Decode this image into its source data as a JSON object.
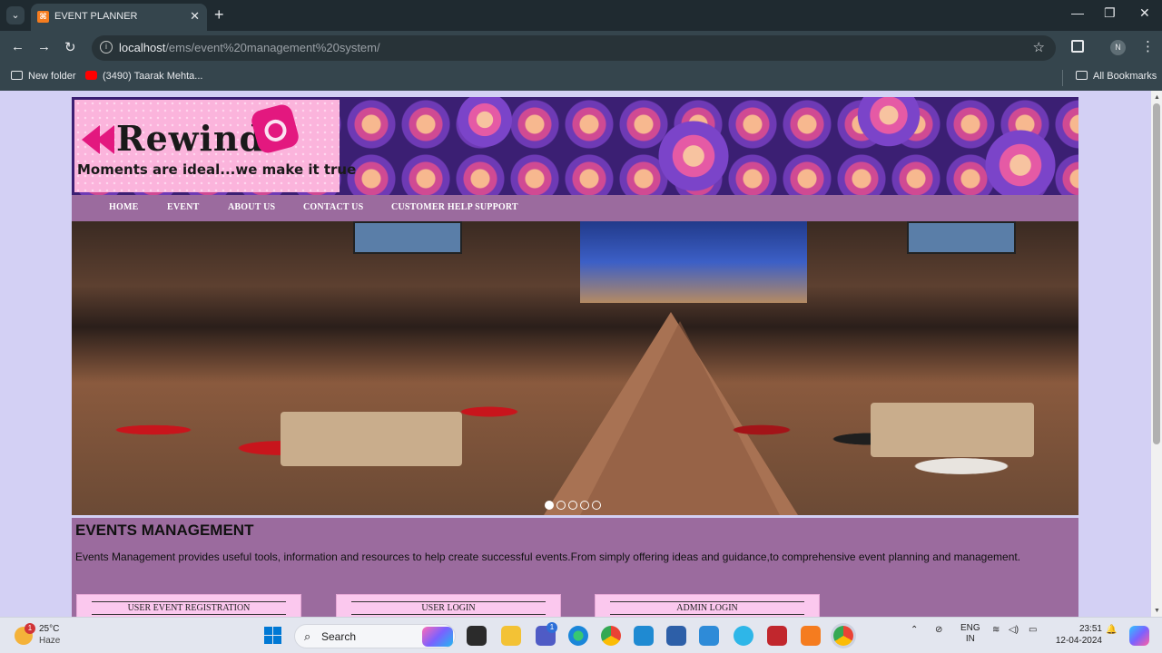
{
  "browser": {
    "tab_title": "EVENT PLANNER",
    "tab_close": "✕",
    "new_tab": "+",
    "url_host": "localhost",
    "url_path": "/ems/event%20management%20system/",
    "profile_initial": "N",
    "window_controls": [
      "—",
      "❐",
      "✕"
    ],
    "bookmarks": [
      {
        "label": "New folder",
        "icon": "folder-icon"
      },
      {
        "label": "(3490) Taarak Mehta...",
        "icon": "youtube-icon"
      }
    ],
    "all_bookmarks": "All Bookmarks"
  },
  "site": {
    "logo": {
      "name": "Rewind",
      "tagline": "Moments are ideal...we make it true"
    },
    "menu": [
      "HOME",
      "EVENT",
      "ABOUT US",
      "CONTACT US",
      "CUSTOMER HELP SUPPORT"
    ],
    "slider": {
      "slide_count": 5,
      "active_index": 0
    },
    "heading": "EVENTS MANAGEMENT",
    "description": "Events Management provides useful tools, information and resources to help create successful events.From simply offering ideas and guidance,to comprehensive event planning and management.",
    "cards": [
      "USER EVENT REGISTRATION",
      "USER LOGIN",
      "ADMIN LOGIN"
    ]
  },
  "taskbar": {
    "weather_temp": "25°C",
    "weather_cond": "Haze",
    "weather_badge": "1",
    "search_label": "Search",
    "lang_1": "ENG",
    "lang_2": "IN",
    "time": "23:51",
    "date": "12-04-2024",
    "teams_badge": "1"
  },
  "colors": {
    "menu_bar": "#9b6b9e",
    "card_bg": "#fbc8ee",
    "page_bg": "#d3d0f4",
    "browser_dark": "#35454d"
  }
}
